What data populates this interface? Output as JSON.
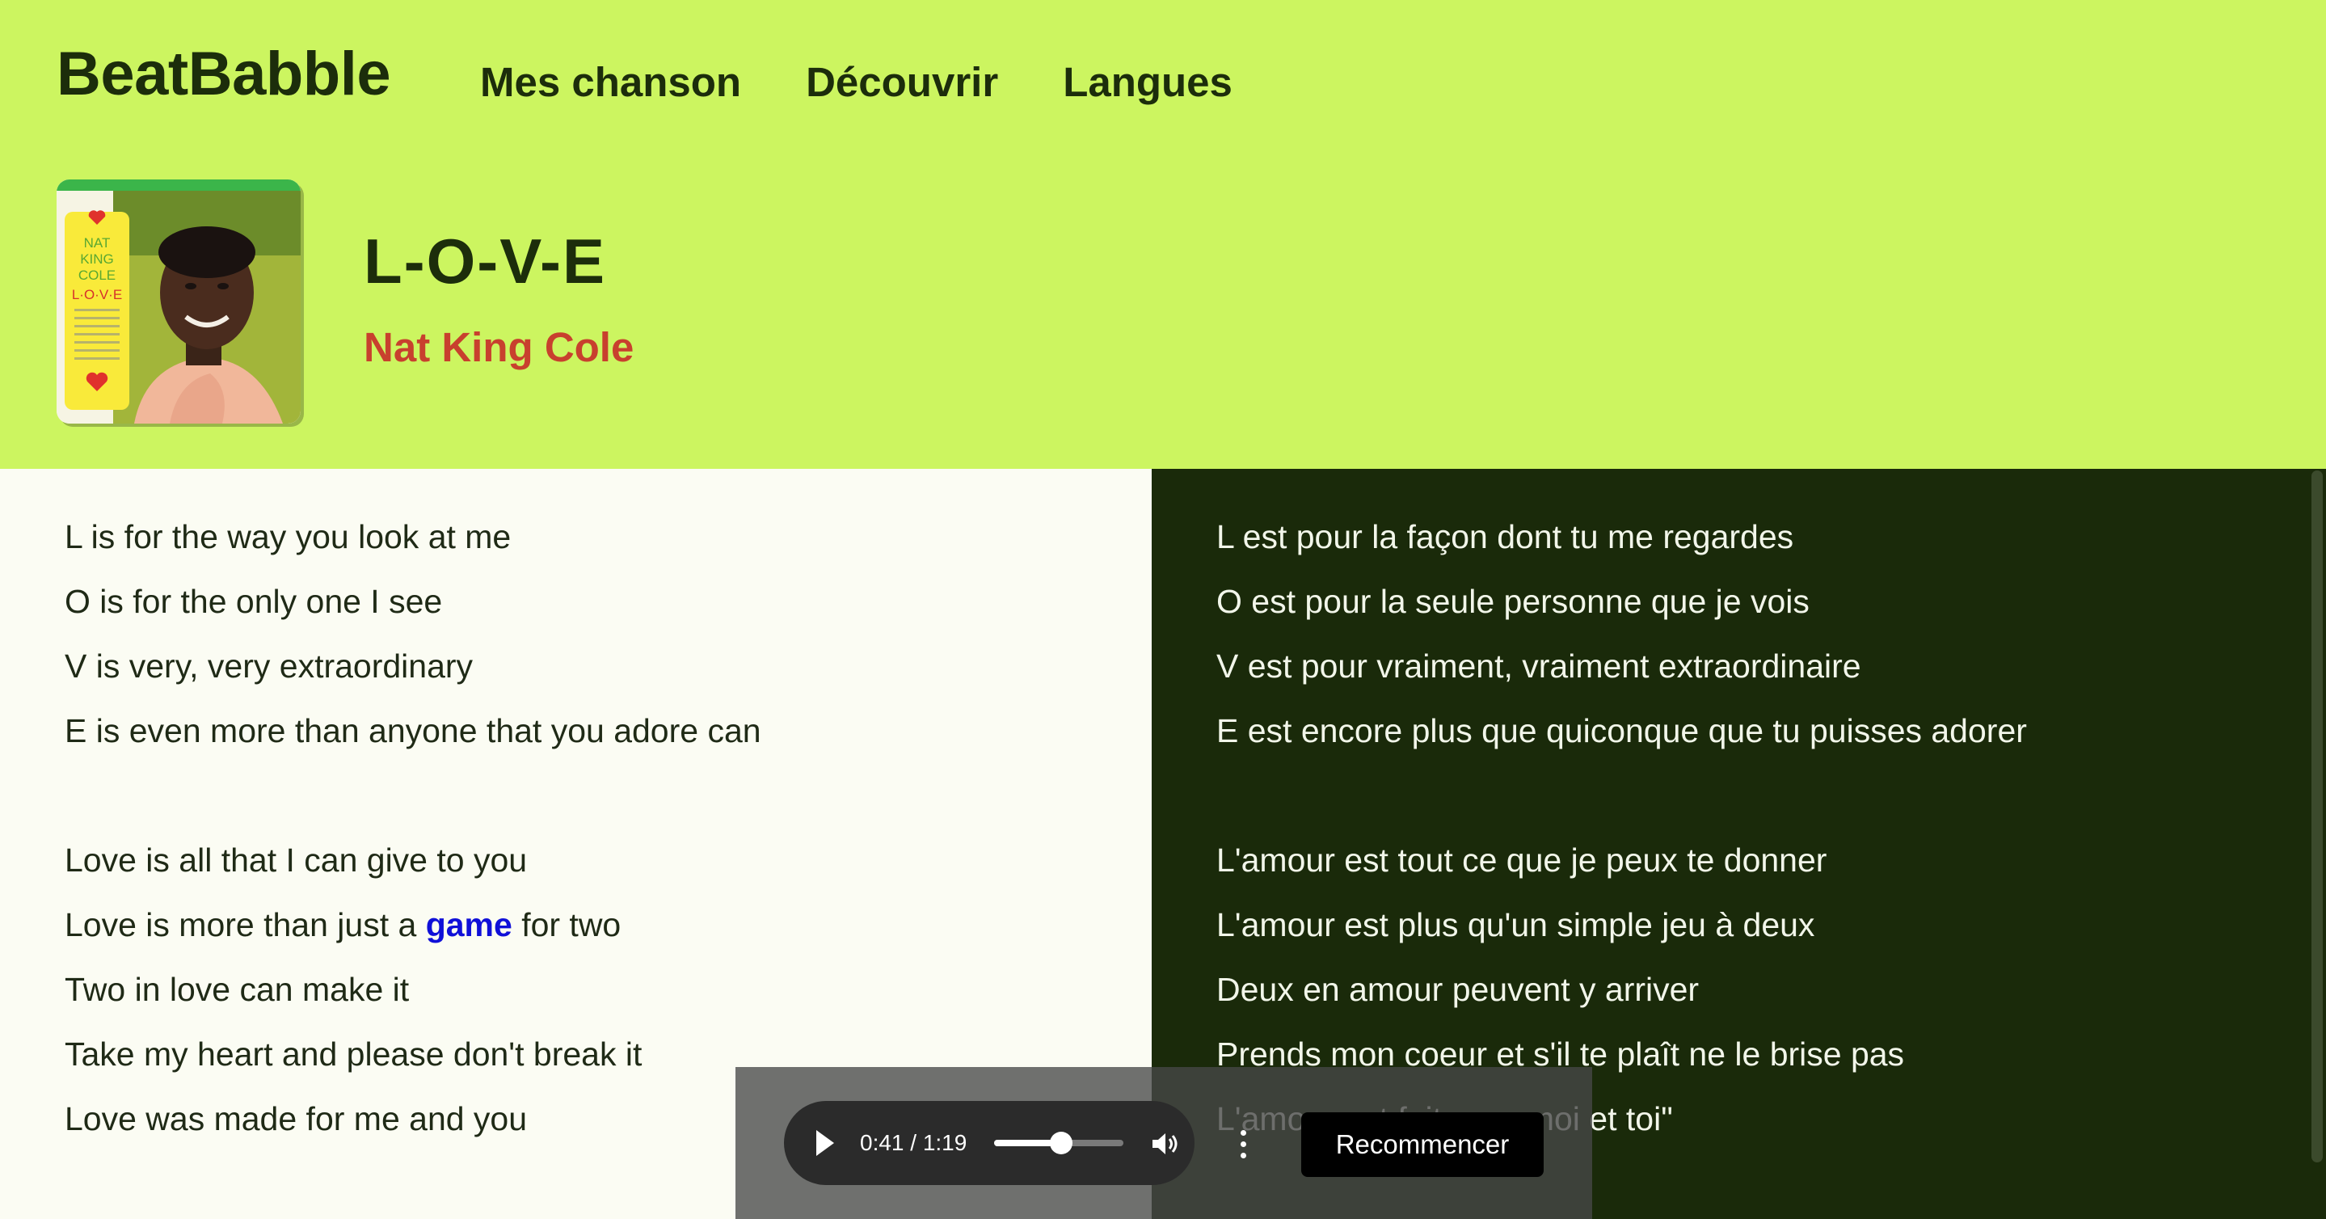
{
  "header": {
    "brand": "BeatBabble",
    "nav": [
      {
        "label": "Mes chanson"
      },
      {
        "label": "Découvrir"
      },
      {
        "label": "Langues"
      }
    ]
  },
  "song": {
    "title": "L-O-V-E",
    "artist": "Nat King Cole",
    "cover": {
      "line1": "NAT",
      "line2": "KING",
      "line3": "COLE",
      "line4": "L·O·V·E"
    }
  },
  "lyrics": {
    "original": [
      "L is for the way you look at me",
      "O is for the only one I see",
      "V is very, very extraordinary",
      "E is even more than anyone that you adore can",
      "",
      "Love is all that I can give to you",
      {
        "before": "Love is more than just a ",
        "word": "game",
        "after": " for two"
      },
      "Two in love can make it",
      "Take my heart and please don't break it",
      "Love was made for me and you"
    ],
    "translation": [
      "L est pour la façon dont tu me regardes",
      "O est pour la seule personne que je vois",
      "V est pour vraiment, vraiment extraordinaire",
      "E est encore plus que quiconque que tu puisses adorer",
      "",
      "L'amour est tout ce que je peux te donner",
      "L'amour est plus qu'un simple jeu à deux",
      "Deux en amour peuvent y arriver",
      "Prends mon coeur et s'il te plaît ne le brise pas",
      "L'amour est fait pour moi et toi\""
    ]
  },
  "player": {
    "time_display": "0:41 / 1:19",
    "progress": 0.52,
    "play_icon": "play-icon",
    "volume_icon": "volume-icon",
    "more_icon": "more-vertical-icon",
    "restart_label": "Recommencer"
  },
  "colors": {
    "header_bg": "#ccf560",
    "artist": "#c8402e",
    "highlight_word": "#1010d8",
    "dark_pane": "#1a2a0a"
  }
}
